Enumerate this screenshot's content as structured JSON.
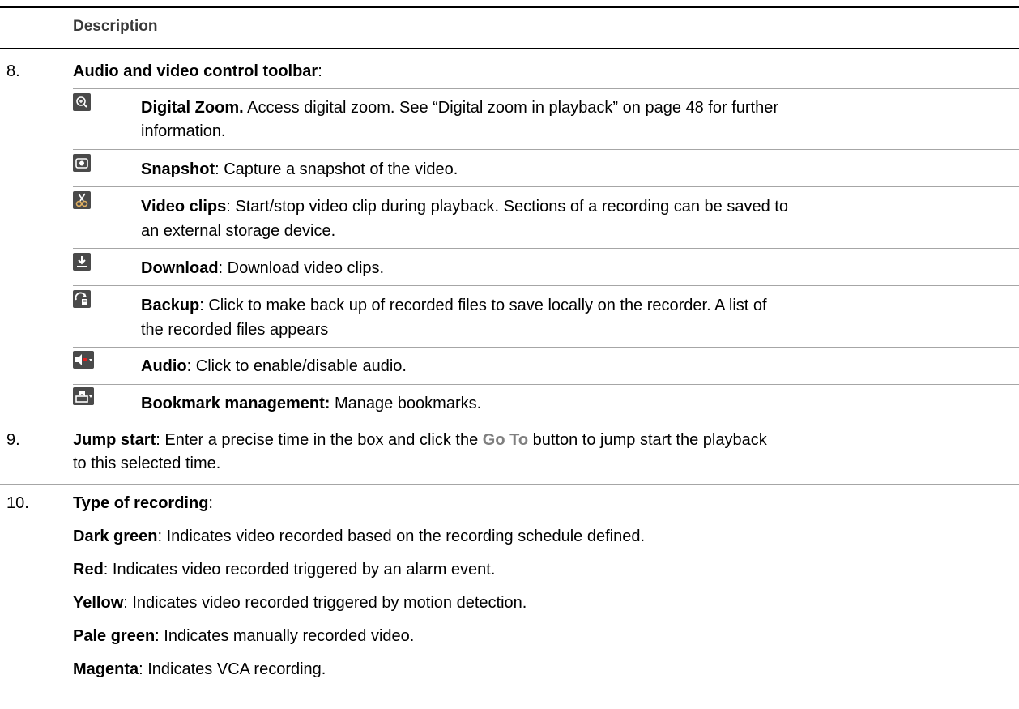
{
  "table": {
    "header": "Description",
    "item8": {
      "number": "8.",
      "title": "Audio and video control toolbar",
      "colon": ":",
      "tools": [
        {
          "icon": "zoom-icon",
          "name": "Digital Zoom.",
          "desc_line1": " Access digital zoom. See “Digital zoom in playback” on page 48 for further",
          "desc_line2": "information."
        },
        {
          "icon": "snapshot-icon",
          "name": "Snapshot",
          "desc_line1": ": Capture a snapshot of the video."
        },
        {
          "icon": "scissors-icon",
          "name": "Video clips",
          "desc_line1": ": Start/stop video clip during playback. Sections of a recording can be saved to",
          "desc_line2": "an external storage device."
        },
        {
          "icon": "download-icon",
          "name": "Download",
          "desc_line1": ": Download video clips."
        },
        {
          "icon": "backup-icon",
          "name": "Backup",
          "desc_line1": ": Click to make back up of recorded files to save locally on the recorder. A list of",
          "desc_line2": "the recorded files appears"
        },
        {
          "icon": "audio-icon",
          "name": "Audio",
          "desc_line1": ": Click to enable/disable audio."
        },
        {
          "icon": "bookmark-icon",
          "name": "Bookmark management:",
          "desc_line1": " Manage bookmarks."
        }
      ]
    },
    "item9": {
      "number": "9.",
      "title": "Jump start",
      "text_a": ": Enter a precise time in the box and click the ",
      "goto": "Go To",
      "text_b": " button to jump start the playback",
      "line2": "to this selected time."
    },
    "item10": {
      "number": "10.",
      "title": "Type of recording",
      "colon": ":",
      "entries": [
        {
          "label": "Dark green",
          "text": ": Indicates video recorded based on the recording schedule defined."
        },
        {
          "label": "Red",
          "text": ": Indicates video recorded triggered by an alarm event."
        },
        {
          "label": "Yellow",
          "text": ": Indicates video recorded triggered by motion detection."
        },
        {
          "label": "Pale green",
          "text": ": Indicates manually recorded video."
        },
        {
          "label": "Magenta",
          "text": ": Indicates VCA recording."
        }
      ]
    }
  }
}
